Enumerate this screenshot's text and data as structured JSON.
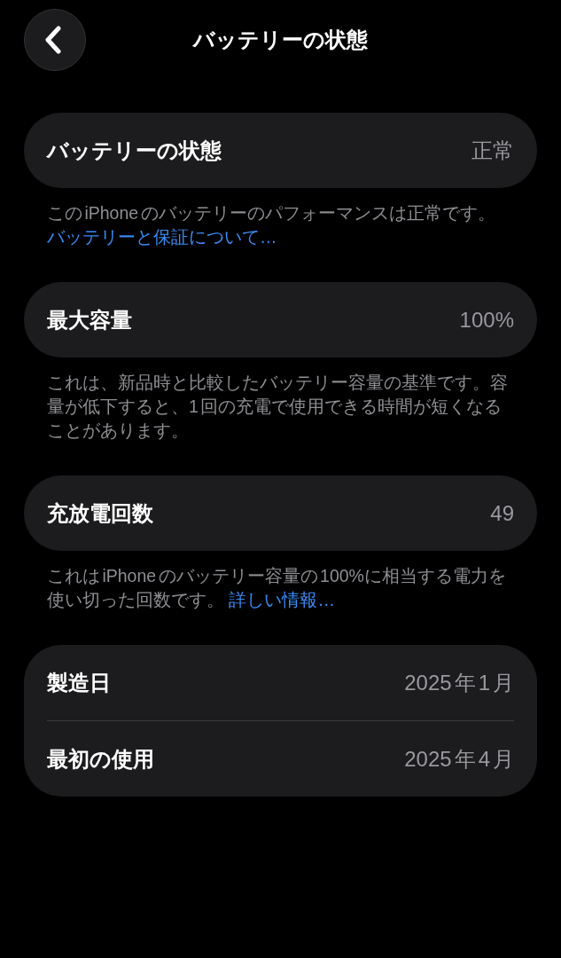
{
  "header": {
    "title": "バッテリーの状態"
  },
  "sections": [
    {
      "rows": [
        {
          "label": "バッテリーの状態",
          "value": "正常"
        }
      ],
      "footnote": {
        "text": "このiPhoneのバッテリーのパフォーマンスは正常です。",
        "link": "バッテリーと保証について…"
      }
    },
    {
      "rows": [
        {
          "label": "最大容量",
          "value": "100%"
        }
      ],
      "footnote": {
        "text": "これは、新品時と比較したバッテリー容量の基準です。容量が低下すると、1回の充電で使用できる時間が短くなることがあります。"
      }
    },
    {
      "rows": [
        {
          "label": "充放電回数",
          "value": "49"
        }
      ],
      "footnote": {
        "text": "これはiPhoneのバッテリー容量の100%に相当する電力を使い切った回数です。",
        "link": "詳しい情報…"
      }
    },
    {
      "rows": [
        {
          "label": "製造日",
          "value": "2025年1月"
        },
        {
          "label": "最初の使用",
          "value": "2025年4月"
        }
      ]
    }
  ]
}
